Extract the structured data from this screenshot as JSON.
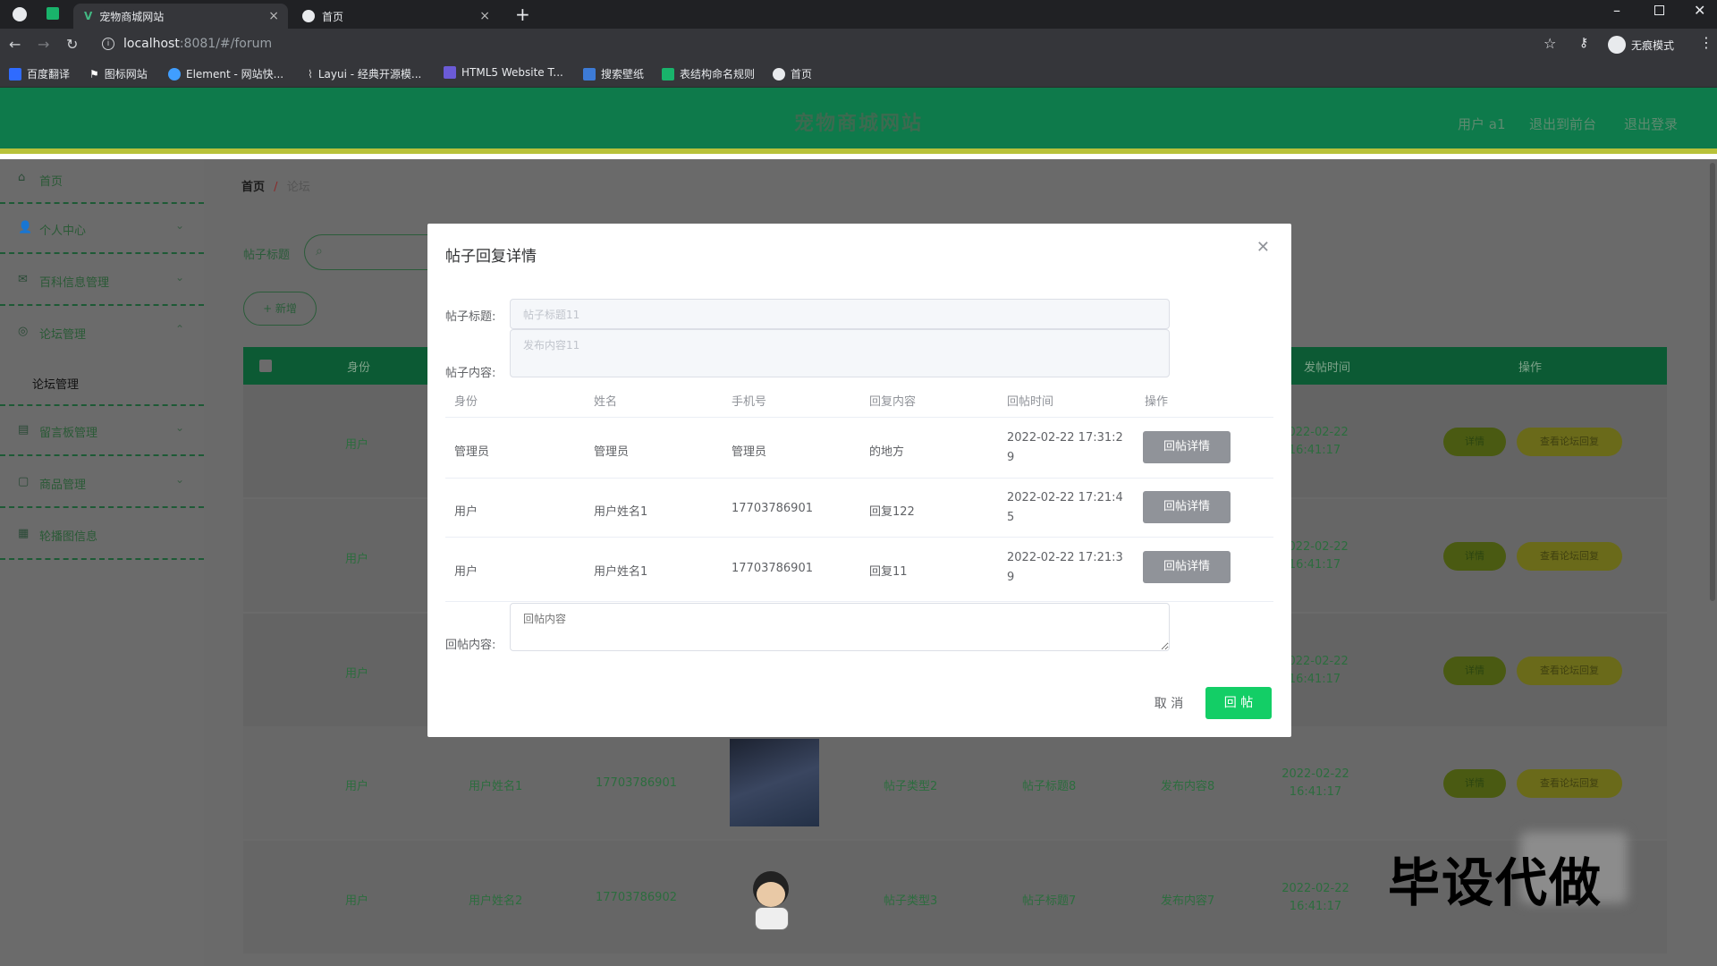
{
  "browser": {
    "tabs": [
      {
        "label": "宠物商城网站"
      },
      {
        "label": "首页"
      }
    ],
    "url_host": "localhost",
    "url_rest": ":8081/#/forum",
    "profile": "无痕模式",
    "bookmarks": [
      {
        "label": "百度翻译",
        "color": "#2f6bff"
      },
      {
        "label": "图标网站",
        "color": "#ffffff"
      },
      {
        "label": "Element - 网站快...",
        "color": "#409eff"
      },
      {
        "label": "Layui - 经典开源模...",
        "color": "#999999"
      },
      {
        "label": "HTML5 Website T...",
        "color": "#6b5bd6"
      },
      {
        "label": "搜索壁纸",
        "color": "#3d7bd6"
      },
      {
        "label": "表结构命名规则",
        "color": "#19b36b"
      },
      {
        "label": "首页",
        "color": "#ffffff"
      }
    ]
  },
  "header": {
    "title": "宠物商城网站",
    "user": "用户 a1",
    "back": "退出到前台",
    "logout": "退出登录"
  },
  "sidebar": {
    "items": [
      {
        "label": "首页",
        "icon": "home-icon",
        "glyph": "⌂"
      },
      {
        "label": "个人中心",
        "icon": "user-icon",
        "glyph": "👤"
      },
      {
        "label": "百科信息管理",
        "icon": "mail-icon",
        "glyph": "✉"
      },
      {
        "label": "论坛管理",
        "icon": "forum-icon",
        "glyph": "◎"
      },
      {
        "label": "论坛管理",
        "icon": "",
        "glyph": ""
      },
      {
        "label": "留言板管理",
        "icon": "board-icon",
        "glyph": "▤"
      },
      {
        "label": "商品管理",
        "icon": "goods-icon",
        "glyph": "▢"
      },
      {
        "label": "轮播图信息",
        "icon": "grid-icon",
        "glyph": "▦"
      }
    ]
  },
  "main": {
    "breadcrumb": {
      "home": "首页",
      "sep": "/",
      "current": "论坛"
    },
    "search_label": "帖子标题",
    "add_label": "+ 新增",
    "table_headers": {
      "identity": "身份",
      "post_time": "发帖时间",
      "action": "操作"
    },
    "rows": [
      {
        "identity": "用户",
        "name": "",
        "phone": "",
        "type": "",
        "title": "",
        "content": "",
        "time": "2022-02-22 16:41:17"
      },
      {
        "identity": "用户",
        "name": "",
        "phone": "",
        "type": "",
        "title": "",
        "content": "",
        "time": "2022-02-22 16:41:17"
      },
      {
        "identity": "用户",
        "name": "",
        "phone": "",
        "type": "",
        "title": "",
        "content": "",
        "time": "2022-02-22 16:41:17"
      },
      {
        "identity": "用户",
        "name": "用户姓名1",
        "phone": "17703786901",
        "type": "帖子类型2",
        "title": "帖子标题8",
        "content": "发布内容8",
        "time": "2022-02-22 16:41:17"
      },
      {
        "identity": "用户",
        "name": "用户姓名2",
        "phone": "17703786902",
        "type": "帖子类型3",
        "title": "帖子标题7",
        "content": "发布内容7",
        "time": "2022-02-22 16:41:17"
      }
    ],
    "detail_btn": "详情",
    "view_reply_btn": "查看论坛回复"
  },
  "dialog": {
    "title": "帖子回复详情",
    "post_title_label": "帖子标题:",
    "post_title_value": "帖子标题11",
    "post_content_label": "帖子内容:",
    "post_content_value": "发布内容11",
    "columns": {
      "identity": "身份",
      "name": "姓名",
      "phone": "手机号",
      "reply": "回复内容",
      "time": "回帖时间",
      "action": "操作"
    },
    "replies": [
      {
        "identity": "管理员",
        "name": "管理员",
        "phone": "管理员",
        "reply": "的地方",
        "time_a": "2022-02-22 17:31:2",
        "time_b": "9"
      },
      {
        "identity": "用户",
        "name": "用户姓名1",
        "phone": "17703786901",
        "reply": "回复122",
        "time_a": "2022-02-22 17:21:4",
        "time_b": "5"
      },
      {
        "identity": "用户",
        "name": "用户姓名1",
        "phone": "17703786901",
        "reply": "回复11",
        "time_a": "2022-02-22 17:21:3",
        "time_b": "9"
      }
    ],
    "reply_detail_btn": "回帖详情",
    "reply_content_label": "回帖内容:",
    "reply_placeholder": "回帖内容",
    "cancel": "取 消",
    "submit": "回 帖"
  },
  "overlay": {
    "text": "毕设代做"
  }
}
